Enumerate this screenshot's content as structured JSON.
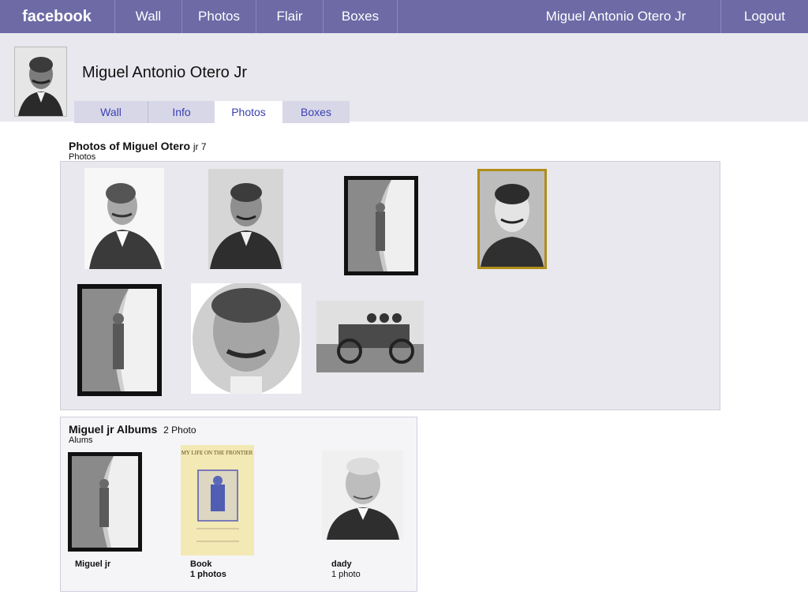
{
  "topbar": {
    "brand": "facebook",
    "nav": [
      "Wall",
      "Photos",
      "Flair",
      "Boxes"
    ],
    "user": "Miguel Antonio Otero Jr",
    "logout": "Logout"
  },
  "profile": {
    "name": "Miguel Antonio Otero Jr",
    "tabs": [
      "Wall",
      "Info",
      "Photos",
      "Boxes"
    ],
    "active_tab": "Photos"
  },
  "photos_section": {
    "title": "Photos of Miguel Otero",
    "count_text": "jr 7",
    "sub": "Photos"
  },
  "albums_section": {
    "title": "Miguel  jr Albums",
    "count_text": "2 Photo",
    "sub": "Alums",
    "albums": [
      {
        "name": "Miguel  jr",
        "count": ""
      },
      {
        "name": "Book",
        "count": "1 photos"
      },
      {
        "name": "dady",
        "count": "1 photo"
      }
    ]
  },
  "book_cover": {
    "title_line": "MY LIFE ON THE FRONTIER"
  }
}
